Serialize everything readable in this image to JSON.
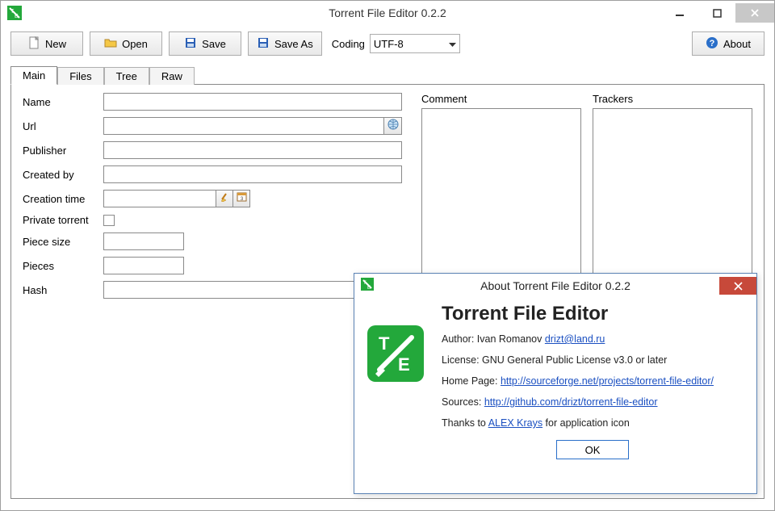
{
  "window": {
    "title": "Torrent File Editor 0.2.2"
  },
  "toolbar": {
    "new": "New",
    "open": "Open",
    "save": "Save",
    "saveAs": "Save As",
    "codingLabel": "Coding",
    "codingValue": "UTF-8",
    "about": "About"
  },
  "tabs": {
    "main": "Main",
    "files": "Files",
    "tree": "Tree",
    "raw": "Raw"
  },
  "form": {
    "nameLabel": "Name",
    "nameValue": "",
    "urlLabel": "Url",
    "urlValue": "",
    "publisherLabel": "Publisher",
    "publisherValue": "",
    "createdByLabel": "Created by",
    "createdByValue": "",
    "creationTimeLabel": "Creation time",
    "creationTimeValue": "",
    "privateTorrentLabel": "Private torrent",
    "pieceSizeLabel": "Piece size",
    "pieceSizeValue": "",
    "piecesLabel": "Pieces",
    "piecesValue": "",
    "hashLabel": "Hash",
    "hashValue": "",
    "commentLabel": "Comment",
    "trackersLabel": "Trackers"
  },
  "about": {
    "title": "About Torrent File Editor 0.2.2",
    "heading": "Torrent File Editor",
    "authorLabel": "Author: ",
    "authorName": "Ivan Romanov ",
    "authorEmail": "drizt@land.ru",
    "licenseLabel": "License: ",
    "licenseValue": "GNU General Public License v3.0 or later",
    "homeLabel": "Home Page: ",
    "homeUrl": "http://sourceforge.net/projects/torrent-file-editor/",
    "sourcesLabel": "Sources: ",
    "sourcesUrl": "http://github.com/drizt/torrent-file-editor",
    "thanksPrefix": "Thanks to ",
    "thanksName": "ALEX Krays",
    "thanksSuffix": " for application icon",
    "ok": "OK"
  }
}
